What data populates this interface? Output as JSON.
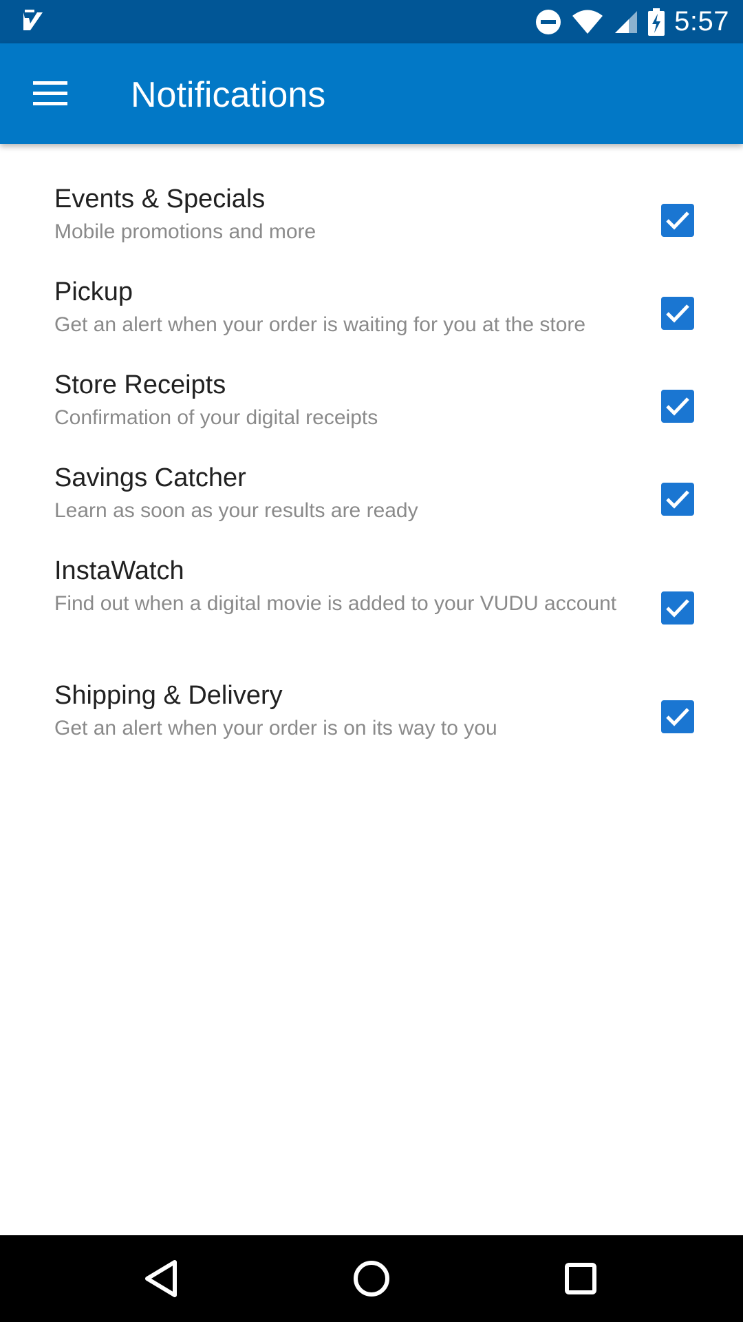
{
  "status_bar": {
    "time": "5:57",
    "icons": [
      "app-check-icon",
      "do-not-disturb-icon",
      "wifi-icon",
      "cell-signal-icon",
      "battery-charging-icon"
    ]
  },
  "app_bar": {
    "title": "Notifications",
    "menu_icon": "hamburger-menu-icon",
    "background": "#0278c6"
  },
  "notifications": [
    {
      "title": "Events & Specials",
      "subtitle": "Mobile promotions and more",
      "checked": true
    },
    {
      "title": "Pickup",
      "subtitle": "Get an alert when your order is waiting for you at the store",
      "checked": true
    },
    {
      "title": "Store Receipts",
      "subtitle": "Confirmation of your digital receipts",
      "checked": true
    },
    {
      "title": "Savings Catcher",
      "subtitle": "Learn as soon as your results are ready",
      "checked": true
    },
    {
      "title": "InstaWatch",
      "subtitle": "Find out when a digital movie is added to your VUDU account",
      "checked": true
    },
    {
      "title": "Shipping & Delivery",
      "subtitle": "Get an alert when your order is on its way to you",
      "checked": true
    }
  ],
  "colors": {
    "status_bar": "#015696",
    "checkbox": "#1a76d2",
    "title_text": "#212121",
    "subtitle_text": "#8a8a8a"
  },
  "nav_bar": {
    "icons": [
      "back-icon",
      "home-icon",
      "recents-icon"
    ]
  }
}
